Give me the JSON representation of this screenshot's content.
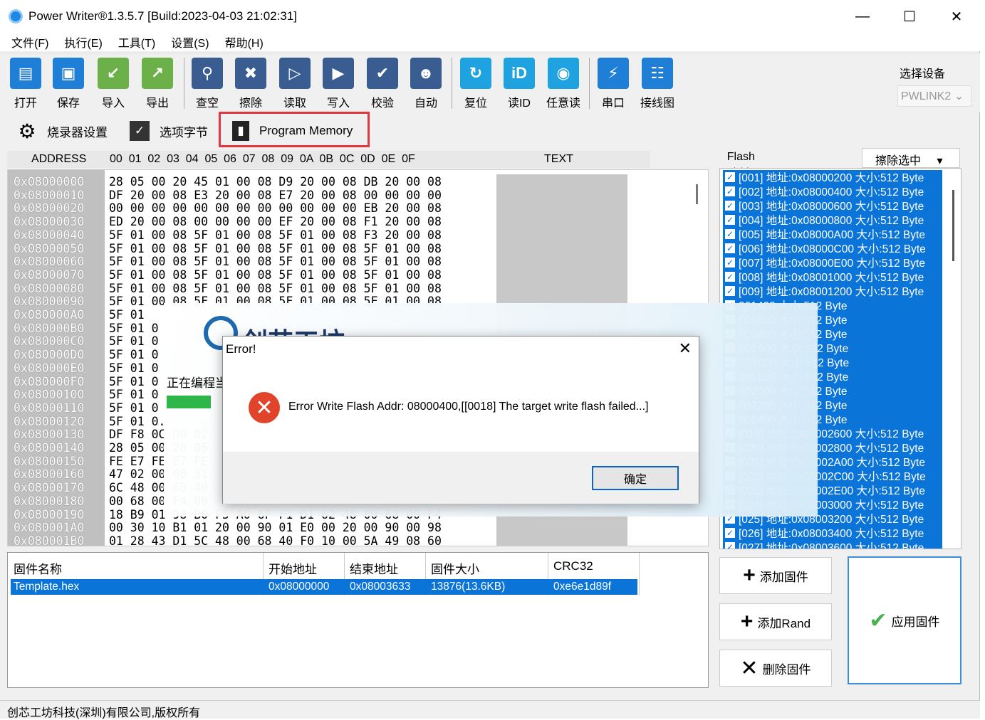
{
  "window": {
    "title": "Power Writer®1.3.5.7 [Build:2023-04-03 21:02:31]",
    "minimize": "—",
    "maximize": "☐",
    "close": "✕"
  },
  "menu": [
    "文件(F)",
    "执行(E)",
    "工具(T)",
    "设置(S)",
    "帮助(H)"
  ],
  "toolbar": [
    {
      "label": "打开",
      "icon": "open-folder-icon",
      "color": "#1f7fd6"
    },
    {
      "label": "保存",
      "icon": "save-icon",
      "color": "#1f7fd6"
    },
    {
      "label": "导入",
      "icon": "import-icon",
      "color": "#6cb04a"
    },
    {
      "label": "导出",
      "icon": "export-icon",
      "color": "#6cb04a"
    },
    {
      "label": "查空",
      "icon": "search-icon",
      "color": "#3a5d91"
    },
    {
      "label": "擦除",
      "icon": "erase-icon",
      "color": "#3a5d91"
    },
    {
      "label": "读取",
      "icon": "read-icon",
      "color": "#3a5d91"
    },
    {
      "label": "写入",
      "icon": "write-icon",
      "color": "#3a5d91"
    },
    {
      "label": "校验",
      "icon": "verify-icon",
      "color": "#3a5d91"
    },
    {
      "label": "自动",
      "icon": "robot-icon",
      "color": "#3a5d91"
    },
    {
      "label": "复位",
      "icon": "reset-icon",
      "color": "#1ea3e0"
    },
    {
      "label": "读ID",
      "icon": "read-id-icon",
      "color": "#1ea3e0"
    },
    {
      "label": "任意读",
      "icon": "arbitrary-read-icon",
      "color": "#1ea3e0"
    },
    {
      "label": "串口",
      "icon": "serial-port-icon",
      "color": "#1f7fd6"
    },
    {
      "label": "接线图",
      "icon": "wiring-diagram-icon",
      "color": "#1f7fd6"
    }
  ],
  "device": {
    "label": "选择设备",
    "value": "PWLINK2"
  },
  "tabs": [
    {
      "label": "烧录器设置",
      "icon": "gear-icon"
    },
    {
      "label": "选项字节",
      "icon": "option-bytes-icon"
    },
    {
      "label": "Program Memory",
      "icon": "memory-chip-icon"
    }
  ],
  "hex_header": {
    "address": "ADDRESS",
    "columns": "00  01  02  03  04  05  06  07  08  09  0A  0B  0C  0D  0E  0F",
    "text": "TEXT"
  },
  "hex_rows": [
    {
      "addr": "0x08000000",
      "bytes": "28 05 00 20 45 01 00 08 D9 20 00 08 DB 20 00 08"
    },
    {
      "addr": "0x08000010",
      "bytes": "DF 20 00 08 E3 20 00 08 E7 20 00 08 00 00 00 00"
    },
    {
      "addr": "0x08000020",
      "bytes": "00 00 00 00 00 00 00 00 00 00 00 00 EB 20 00 08"
    },
    {
      "addr": "0x08000030",
      "bytes": "ED 20 00 08 00 00 00 00 EF 20 00 08 F1 20 00 08"
    },
    {
      "addr": "0x08000040",
      "bytes": "5F 01 00 08 5F 01 00 08 5F 01 00 08 F3 20 00 08"
    },
    {
      "addr": "0x08000050",
      "bytes": "5F 01 00 08 5F 01 00 08 5F 01 00 08 5F 01 00 08"
    },
    {
      "addr": "0x08000060",
      "bytes": "5F 01 00 08 5F 01 00 08 5F 01 00 08 5F 01 00 08"
    },
    {
      "addr": "0x08000070",
      "bytes": "5F 01 00 08 5F 01 00 08 5F 01 00 08 5F 01 00 08"
    },
    {
      "addr": "0x08000080",
      "bytes": "5F 01 00 08 5F 01 00 08 5F 01 00 08 5F 01 00 08"
    },
    {
      "addr": "0x08000090",
      "bytes": "5F 01 00 08 5F 01 00 08 5F 01 00 08 5F 01 00 08"
    },
    {
      "addr": "0x080000A0",
      "bytes": "5F 01"
    },
    {
      "addr": "0x080000B0",
      "bytes": "5F 01 0"
    },
    {
      "addr": "0x080000C0",
      "bytes": "5F 01 0"
    },
    {
      "addr": "0x080000D0",
      "bytes": "5F 01 0"
    },
    {
      "addr": "0x080000E0",
      "bytes": "5F 01 0"
    },
    {
      "addr": "0x080000F0",
      "bytes": "5F 01 0"
    },
    {
      "addr": "0x08000100",
      "bytes": "5F 01 0"
    },
    {
      "addr": "0x08000110",
      "bytes": "5F 01 0"
    },
    {
      "addr": "0x08000120",
      "bytes": "5F 01 0."
    },
    {
      "addr": "0x08000130",
      "bytes": "DF F8 0C D0 02"
    },
    {
      "addr": "0x08000140",
      "bytes": "28 05 00 20 06"
    },
    {
      "addr": "0x08000150",
      "bytes": "FE E7 FE E7 FE"
    },
    {
      "addr": "0x08000160",
      "bytes": "47 02 00 08 31"
    },
    {
      "addr": "0x08000170",
      "bytes": "6C 48 00 68 40"
    },
    {
      "addr": "0x08000180",
      "bytes": "00 68 00 F4 00"
    },
    {
      "addr": "0x08000190",
      "bytes": "18 B9 01 98 B0 F5 A0 6F F1 D1 62 48 00 68 00 F4"
    },
    {
      "addr": "0x080001A0",
      "bytes": "00 30 10 B1 01 20 00 90 01 E0 00 20 00 90 00 98"
    },
    {
      "addr": "0x080001B0",
      "bytes": "01 28 43 D1 5C 48 00 68 40 F0 10 00 5A 49 08 60"
    }
  ],
  "flash": {
    "checkbox_label": "Flash 映射(全/反选):",
    "erase_mode": "擦除选中",
    "items": [
      "[001] 地址:0x08000200 大小:512 Byte",
      "[002] 地址:0x08000400 大小:512 Byte",
      "[003] 地址:0x08000600 大小:512 Byte",
      "[004] 地址:0x08000800 大小:512 Byte",
      "[005] 地址:0x08000A00 大小:512 Byte",
      "[006] 地址:0x08000C00 大小:512 Byte",
      "[007] 地址:0x08000E00 大小:512 Byte",
      "[008] 地址:0x08001000 大小:512 Byte",
      "[009] 地址:0x08001200 大小:512 Byte",
      "001400 大小:512 Byte",
      "001600 大小:512 Byte",
      "001800 大小:512 Byte",
      "001A00 大小:512 Byte",
      "001C00 大小:512 Byte",
      "001E00 大小:512 Byte",
      "002000 大小:512 Byte",
      "002200 大小:512 Byte",
      "002400 大小:512 Byte",
      "[019] 地址:0x08002600 大小:512 Byte",
      "[020] 地址:0x08002800 大小:512 Byte",
      "[021] 地址:0x08002A00 大小:512 Byte",
      "[022] 地址:0x08002C00 大小:512 Byte",
      "[023] 地址:0x08002E00 大小:512 Byte",
      "[024] 地址:0x08003000 大小:512 Byte",
      "[025] 地址:0x08003200 大小:512 Byte",
      "[026] 地址:0x08003400 大小:512 Byte",
      "[027] 地址:0x08003600 大小:512 Byte"
    ]
  },
  "firmware": {
    "headers": [
      "固件名称",
      "开始地址",
      "结束地址",
      "固件大小",
      "CRC32"
    ],
    "rows": [
      [
        "Template.hex",
        "0x08000000",
        "0x08003633",
        "13876(13.6KB)",
        "0xe6e1d89f"
      ]
    ]
  },
  "buttons": {
    "add_firmware": "添加固件",
    "add_rand": "添加Rand",
    "delete_firmware": "删除固件",
    "apply_firmware": "应用固件"
  },
  "splash": {
    "title": "创芯工坊",
    "progress_label": "正在编程当"
  },
  "dialog": {
    "title": "Error!",
    "message": "Error Write Flash Addr: 08000400,[[0018] The target write flash failed...]",
    "ok": "确定"
  },
  "status": "创芯工坊科技(深圳)有限公司,版权所有"
}
